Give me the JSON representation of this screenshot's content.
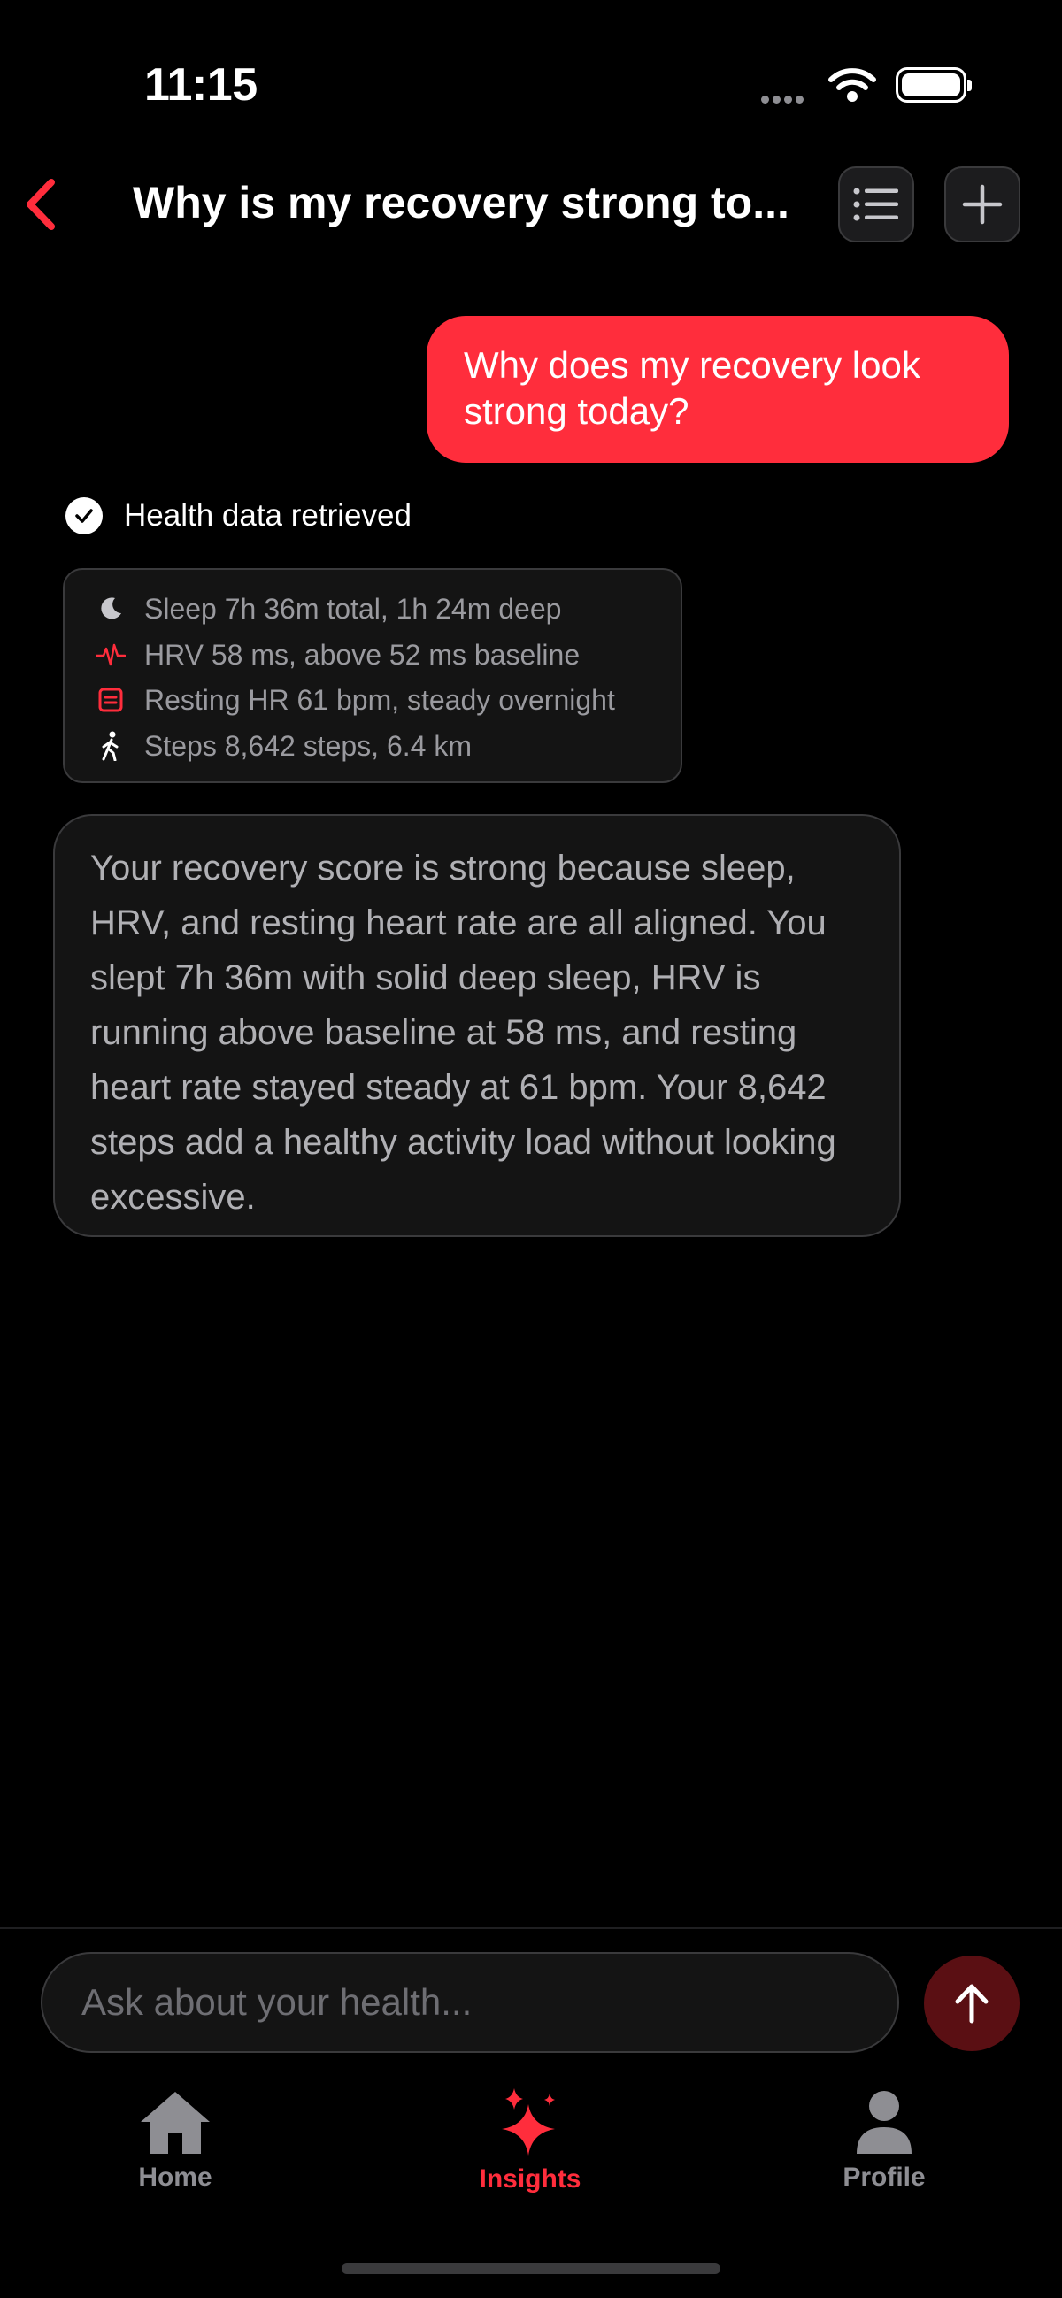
{
  "status_bar": {
    "time": "11:15",
    "icons": [
      "signal-icon",
      "wifi-icon",
      "battery-icon"
    ]
  },
  "header": {
    "title": "Why is my recovery strong to...",
    "back_icon": "chevron-left-icon",
    "list_icon": "list-icon",
    "new_chat_icon": "plus-icon"
  },
  "conversation": {
    "user_message": "Why does my recovery look strong today?",
    "retrieval_status": "Health data retrieved",
    "health_data": [
      {
        "icon": "moon-icon",
        "text": "Sleep 7h 36m total, 1h 24m deep"
      },
      {
        "icon": "heartbeat-icon",
        "text": "HRV 58 ms, above 52 ms baseline"
      },
      {
        "icon": "heart-rate-icon",
        "text": "Resting HR 61 bpm, steady overnight"
      },
      {
        "icon": "walking-icon",
        "text": "Steps 8,642 steps, 6.4 km"
      }
    ],
    "assistant_message": "Your recovery score is strong because sleep, HRV, and resting heart rate are all aligned. You slept 7h 36m with solid deep sleep, HRV is running above baseline at 58 ms, and resting heart rate stayed steady at 61 bpm. Your 8,642 steps add a healthy activity load without looking excessive."
  },
  "composer": {
    "placeholder": "Ask about your health...",
    "send_icon": "arrow-up-icon"
  },
  "tab_bar": {
    "tabs": [
      {
        "label": "Home",
        "icon": "home-icon",
        "active": false
      },
      {
        "label": "Insights",
        "icon": "sparkles-icon",
        "active": true
      },
      {
        "label": "Profile",
        "icon": "person-icon",
        "active": false
      }
    ]
  },
  "colors": {
    "accent": "#ff2d3c",
    "background": "#000000",
    "card": "#141414",
    "send_button": "#5a0f13"
  }
}
